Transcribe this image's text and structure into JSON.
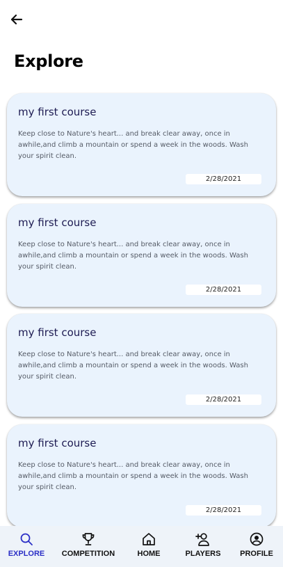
{
  "header": {
    "back_icon": "arrow-left-icon",
    "title": "Explore"
  },
  "courses": [
    {
      "title": "my first course",
      "description": "Keep close to Nature's heart... and break clear away, once in awhile,and climb a mountain or spend a week in the woods. Wash your spirit clean.",
      "date": "2/28/2021"
    },
    {
      "title": "my first course",
      "description": "Keep close to Nature's heart... and break clear away, once in awhile,and climb a mountain or spend a week in the woods. Wash your spirit clean.",
      "date": "2/28/2021"
    },
    {
      "title": "my first course",
      "description": "Keep close to Nature's heart... and break clear away, once in awhile,and climb a mountain or spend a week in the woods. Wash your spirit clean.",
      "date": "2/28/2021"
    },
    {
      "title": "my first course",
      "description": "Keep close to Nature's heart... and break clear away, once in awhile,and climb a mountain or spend a week in the woods. Wash your spirit clean.",
      "date": "2/28/2021"
    }
  ],
  "bottom_nav": {
    "items": [
      {
        "label": "EXPLORE",
        "icon": "search-icon",
        "active": true
      },
      {
        "label": "COMPETITION",
        "icon": "trophy-icon",
        "active": false
      },
      {
        "label": "HOME",
        "icon": "home-icon",
        "active": false
      },
      {
        "label": "PLAYERS",
        "icon": "add-user-icon",
        "active": false
      },
      {
        "label": "PROFILE",
        "icon": "profile-icon",
        "active": false
      }
    ]
  },
  "colors": {
    "accent": "#2b2fc6",
    "card_background": "#eaf3fd",
    "card_title": "#1d1b52",
    "nav_background": "#eef3f9"
  }
}
